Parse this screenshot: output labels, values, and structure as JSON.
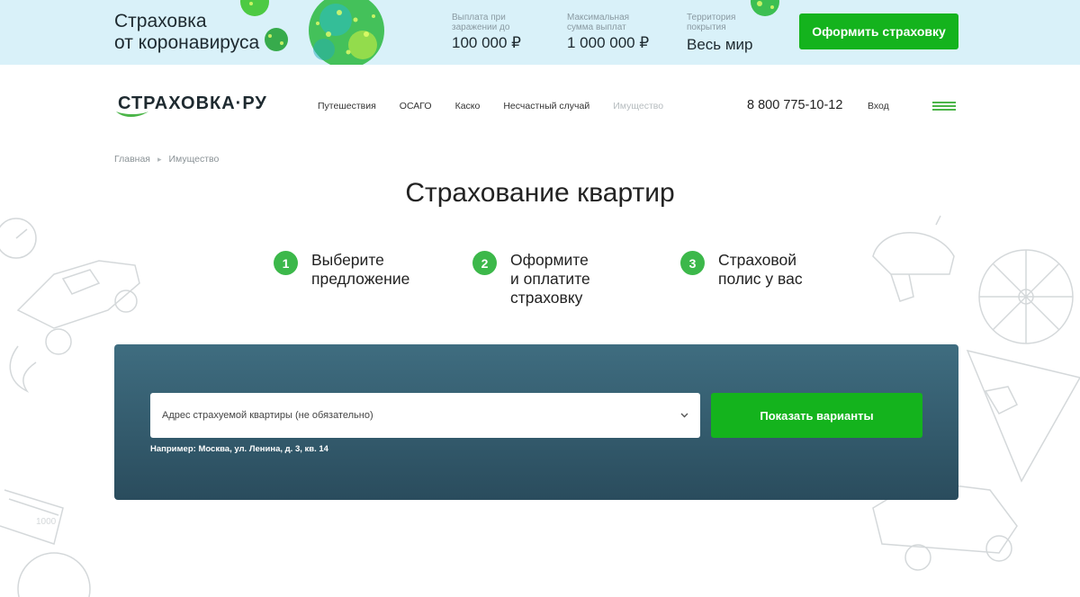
{
  "promo": {
    "title_line1": "Страховка",
    "title_line2": "от коронавируса",
    "stats": [
      {
        "label_line1": "Выплата при",
        "label_line2": "заражении до",
        "value": "100 000 ₽"
      },
      {
        "label_line1": "Максимальная",
        "label_line2": "сумма выплат",
        "value": "1 000 000 ₽"
      },
      {
        "label_line1": "Территория",
        "label_line2": "покрытия",
        "value": "Весь мир"
      }
    ],
    "button_label": "Оформить страховку"
  },
  "header": {
    "logo_text": "СТРАХОВКА·РУ",
    "nav": [
      {
        "label": "Путешествия"
      },
      {
        "label": "ОСАГО"
      },
      {
        "label": "Каско"
      },
      {
        "label": "Несчастный случай"
      },
      {
        "label": "Имущество"
      }
    ],
    "phone": "8 800 775-10-12",
    "login_label": "Вход"
  },
  "breadcrumb": {
    "home": "Главная",
    "current": "Имущество"
  },
  "page_title": "Страхование квартир",
  "steps": [
    {
      "number": "1",
      "line1": "Выберите",
      "line2": "предложение",
      "line3": ""
    },
    {
      "number": "2",
      "line1": "Оформите",
      "line2": "и оплатите",
      "line3": "страховку"
    },
    {
      "number": "3",
      "line1": "Страховой",
      "line2": "полис у вас",
      "line3": ""
    }
  ],
  "search": {
    "address_placeholder": "Адрес страхуемой квартиры (не обязательно)",
    "hint": "Например: Москва, ул. Ленина, д. 3, кв. 14",
    "button_label": "Показать варианты"
  },
  "colors": {
    "accent_green": "#14b31d",
    "step_green": "#3cb84a",
    "panel_top": "#3f6d80",
    "panel_bottom": "#2a4c5d",
    "promo_bg": "#d9f1f9"
  }
}
